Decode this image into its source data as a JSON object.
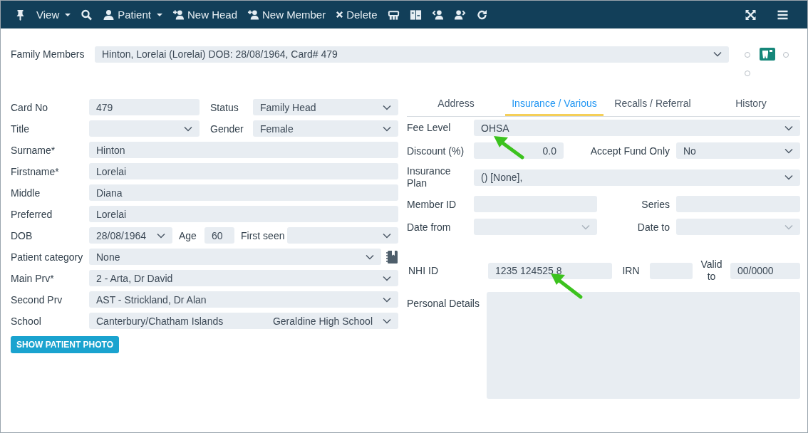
{
  "toolbar": {
    "items": [
      {
        "kind": "pin"
      },
      {
        "kind": "none",
        "label": "View",
        "dropdown": true
      },
      {
        "kind": "search"
      },
      {
        "kind": "person",
        "label": "Patient",
        "dropdown": true
      },
      {
        "kind": "personplus",
        "label": "New Head",
        "dropdown": false
      },
      {
        "kind": "personplus",
        "label": "New Member",
        "dropdown": false
      },
      {
        "kind": "close",
        "label": "Delete",
        "dropdown": false
      },
      {
        "kind": "cms"
      },
      {
        "kind": "book"
      },
      {
        "kind": "personleft"
      },
      {
        "kind": "personright"
      },
      {
        "kind": "refresh"
      }
    ],
    "right_items": [
      {
        "kind": "expand"
      },
      {
        "kind": "menu"
      }
    ]
  },
  "family_members": {
    "label": "Family Members",
    "value": "Hinton, Lorelai (Lorelai) DOB: 28/08/1964, Card# 479"
  },
  "left_form": [
    {
      "kind": "pair",
      "fields": [
        {
          "label": "Card No",
          "value": "479",
          "kind": "text"
        },
        {
          "label": "Status",
          "value": "Family Head",
          "kind": "select"
        }
      ]
    },
    {
      "kind": "pair",
      "fields": [
        {
          "label": "Title",
          "kind": "select"
        },
        {
          "label": "Gender",
          "value": "Female",
          "kind": "select"
        }
      ]
    },
    {
      "kind": "single",
      "fields": [
        {
          "label": "Surname*",
          "value": "Hinton",
          "kind": "text"
        }
      ]
    },
    {
      "kind": "single",
      "fields": [
        {
          "label": "Firstname*",
          "value": "Lorelai",
          "kind": "text"
        }
      ]
    },
    {
      "kind": "single",
      "fields": [
        {
          "label": "Middle",
          "value": "Diana",
          "kind": "text"
        }
      ]
    },
    {
      "kind": "single",
      "fields": [
        {
          "label": "Preferred",
          "value": "Lorelai",
          "kind": "text"
        }
      ]
    },
    {
      "kind": "dob",
      "fields": [
        {
          "label": "DOB",
          "value": "28/08/1964",
          "kind": "select"
        },
        {
          "label": "Age",
          "value": "60",
          "kind": "text"
        },
        {
          "label": "First seen",
          "kind": "select"
        }
      ]
    },
    {
      "kind": "single",
      "fields": [
        {
          "label": "Patient category",
          "value": "None",
          "kind": "notebook"
        }
      ]
    },
    {
      "kind": "single",
      "fields": [
        {
          "label": "Main Prv*",
          "value": "2 - Arta, Dr David",
          "kind": "select"
        }
      ]
    },
    {
      "kind": "single",
      "fields": [
        {
          "label": "Second Prv",
          "value": "AST - Strickland, Dr Alan",
          "kind": "select"
        }
      ]
    },
    {
      "kind": "single",
      "fields": [
        {
          "label": "School",
          "value": "Canterbury/Chatham Islands",
          "value_2": "Geraldine High School",
          "kind": "double"
        }
      ]
    }
  ],
  "photo_button": "SHOW PATIENT PHOTO",
  "tabs": [
    {
      "label": "Address",
      "selected": false
    },
    {
      "label": "Insurance / Various",
      "selected": true
    },
    {
      "label": "Recalls / Referral",
      "selected": false
    },
    {
      "label": "History",
      "selected": false
    }
  ],
  "right_form": [
    {
      "kind": "single",
      "fields": [
        {
          "label": "Fee Level",
          "value": "OHSA",
          "kind": "select"
        }
      ]
    },
    {
      "kind": "split",
      "fields": [
        {
          "label": "Discount (%)",
          "value": "0.0",
          "kind": "number"
        },
        {
          "label": "Accept Fund Only",
          "value": "No",
          "kind": "select"
        }
      ]
    },
    {
      "kind": "single",
      "fields": [
        {
          "label": "Insurance Plan",
          "value": "() [None],",
          "kind": "select"
        }
      ]
    },
    {
      "kind": "halves",
      "fields": [
        {
          "label": "Member ID",
          "kind": "text"
        },
        {
          "label": "Series",
          "kind": "text"
        }
      ]
    },
    {
      "kind": "halves",
      "fields": [
        {
          "label": "Date from",
          "kind": "faint"
        },
        {
          "label": "Date to",
          "kind": "faint"
        }
      ]
    },
    {
      "kind": "nhi",
      "fields": [
        {
          "label": "NHI ID",
          "value": "1235 124525 8",
          "kind": "text"
        },
        {
          "label": "IRN",
          "kind": "text"
        },
        {
          "label": "Valid to",
          "value": "00/0000",
          "kind": "text"
        }
      ]
    },
    {
      "kind": "area",
      "fields": [
        {
          "label": "Personal Details",
          "kind": "textarea"
        }
      ]
    }
  ]
}
